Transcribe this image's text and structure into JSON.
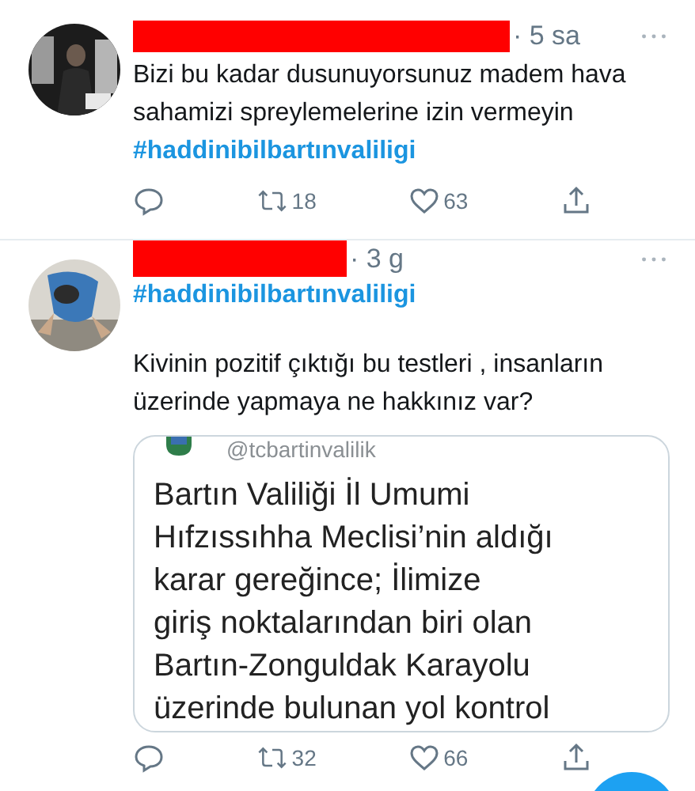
{
  "tweets": [
    {
      "name_redacted": true,
      "time": "· 5 sa",
      "parts": [
        {
          "kind": "text",
          "text": "Bizi bu kadar dusunuyorsunuz madem hava sahamizi spreylemelerine izin vermeyin"
        },
        {
          "kind": "hashtag",
          "text": "#haddinibilbartınvaliligi"
        }
      ],
      "retweets": "18",
      "likes": "63"
    },
    {
      "name_redacted": true,
      "time": "· 3 g",
      "parts": [
        {
          "kind": "hashtag",
          "text": "#haddinibilbartınvaliligi"
        },
        {
          "kind": "text",
          "text": "Kivinin pozitif çıktığı bu testleri , insanların üzerinde yapmaya ne hakkınız var?"
        }
      ],
      "embed": {
        "handle": "@tcbartinvalilik",
        "lines": [
          "Bartın Valiliği İl Umumi",
          "Hıfzıssıhha Meclisi’nin aldığı",
          "karar gereğince; İlimize",
          "giriş noktalarından biri olan",
          "Bartın-Zonguldak Karayolu",
          "üzerinde bulunan yol kontrol"
        ]
      },
      "retweets": "32",
      "likes": "66"
    }
  ]
}
